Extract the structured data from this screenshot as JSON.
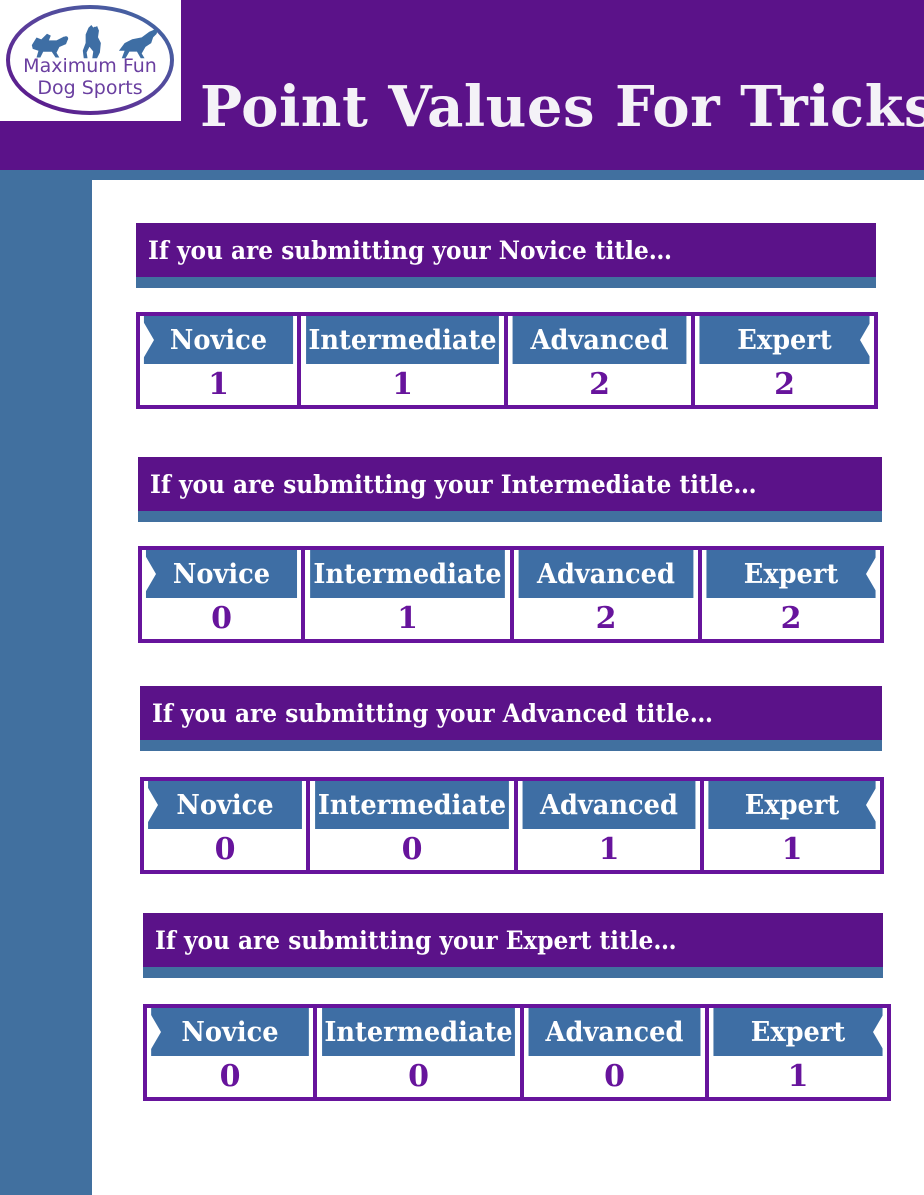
{
  "header": {
    "title": "Point Values For Tricks",
    "logo": {
      "line1": "Maximum Fun",
      "line2": "Dog Sports",
      "alt": "Maximum Fun Dog Sports logo"
    }
  },
  "colors": {
    "purple": "#5B1289",
    "purple_bright": "#67149C",
    "blue": "#41709F",
    "blue_header": "#3E6EA4",
    "white": "#FFFFFF"
  },
  "columns": [
    "Novice",
    "Intermediate",
    "Advanced",
    "Expert"
  ],
  "sections": [
    {
      "banner": "If you are submitting your Novice title…",
      "values": [
        "1",
        "1",
        "2",
        "2"
      ]
    },
    {
      "banner": "If you are submitting your Intermediate title…",
      "values": [
        "0",
        "1",
        "2",
        "2"
      ]
    },
    {
      "banner": "If you are submitting your Advanced title…",
      "values": [
        "0",
        "0",
        "1",
        "1"
      ]
    },
    {
      "banner": "If you are submitting your Expert title…",
      "values": [
        "0",
        "0",
        "0",
        "1"
      ]
    }
  ],
  "chart_data": {
    "type": "table",
    "title": "Point Values For Tricks",
    "columns": [
      "Novice",
      "Intermediate",
      "Advanced",
      "Expert"
    ],
    "rows": [
      {
        "label": "If you are submitting your Novice title…",
        "values": [
          1,
          1,
          2,
          2
        ]
      },
      {
        "label": "If you are submitting your Intermediate title…",
        "values": [
          0,
          1,
          2,
          2
        ]
      },
      {
        "label": "If you are submitting your Advanced title…",
        "values": [
          0,
          0,
          1,
          1
        ]
      },
      {
        "label": "If you are submitting your Expert title…",
        "values": [
          0,
          0,
          0,
          1
        ]
      }
    ]
  }
}
